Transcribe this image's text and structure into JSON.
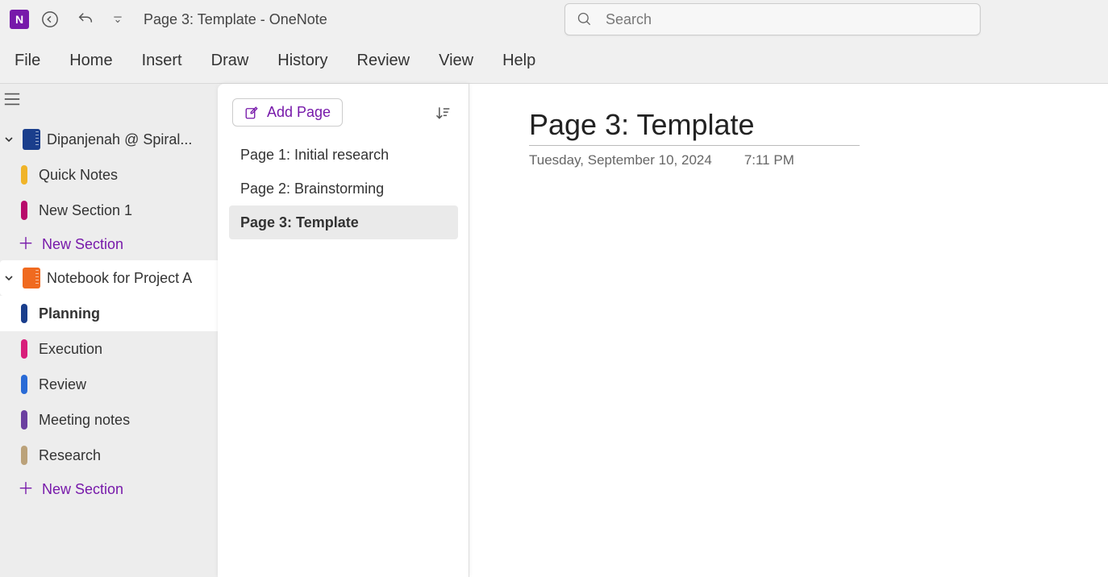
{
  "titlebar": {
    "app_icon_text": "N",
    "doc_title": "Page 3: Template  -  OneNote"
  },
  "search": {
    "placeholder": "Search",
    "value": ""
  },
  "ribbon": {
    "tabs": [
      "File",
      "Home",
      "Insert",
      "Draw",
      "History",
      "Review",
      "View",
      "Help"
    ]
  },
  "nav": {
    "notebooks": [
      {
        "label": "Dipanjenah @ Spiral...",
        "color": "blue",
        "active": false,
        "sections": [
          {
            "label": "Quick Notes",
            "color": "#f0b429",
            "selected": false
          },
          {
            "label": "New Section 1",
            "color": "#b80a6b",
            "selected": false
          }
        ],
        "new_section_label": "New Section"
      },
      {
        "label": "Notebook for Project A",
        "color": "orange",
        "active": true,
        "sections": [
          {
            "label": "Planning",
            "color": "#1a3e8c",
            "selected": true
          },
          {
            "label": "Execution",
            "color": "#d81e7a",
            "selected": false
          },
          {
            "label": "Review",
            "color": "#2a6bd6",
            "selected": false
          },
          {
            "label": "Meeting notes",
            "color": "#6b3fa0",
            "selected": false
          },
          {
            "label": "Research",
            "color": "#bba27a",
            "selected": false
          }
        ],
        "new_section_label": "New Section"
      }
    ]
  },
  "pagelist": {
    "add_page_label": "Add Page",
    "pages": [
      {
        "label": "Page 1: Initial research",
        "selected": false
      },
      {
        "label": "Page 2: Brainstorming",
        "selected": false
      },
      {
        "label": "Page 3: Template",
        "selected": true
      }
    ]
  },
  "canvas": {
    "title": "Page 3: Template",
    "date": "Tuesday, September 10, 2024",
    "time": "7:11 PM"
  }
}
